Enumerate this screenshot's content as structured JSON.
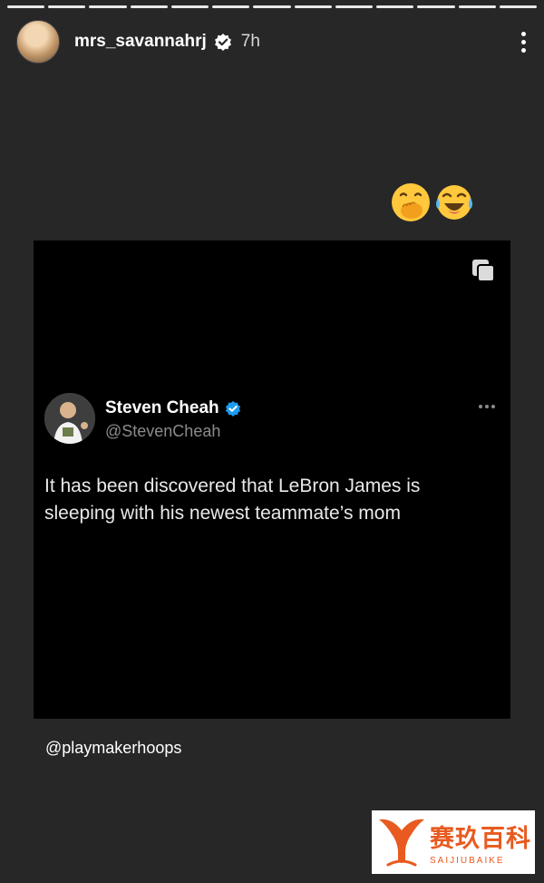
{
  "story": {
    "progress_segments": 13,
    "username": "mrs_savannahrj",
    "time": "7h",
    "emojis": [
      "face-with-hand-over-mouth",
      "tears-of-joy"
    ],
    "caption": "@playmakerhoops"
  },
  "tweet": {
    "name": "Steven Cheah",
    "handle": "@StevenCheah",
    "text": "It has been discovered that LeBron James is sleeping with his newest teammate’s mom"
  },
  "watermark": {
    "cn": "赛玖百科",
    "en": "SAIJIUBAIKE"
  },
  "colors": {
    "background": "#272727",
    "verified_blue": "#1d9bf0",
    "watermark_orange": "#e85a1f"
  }
}
